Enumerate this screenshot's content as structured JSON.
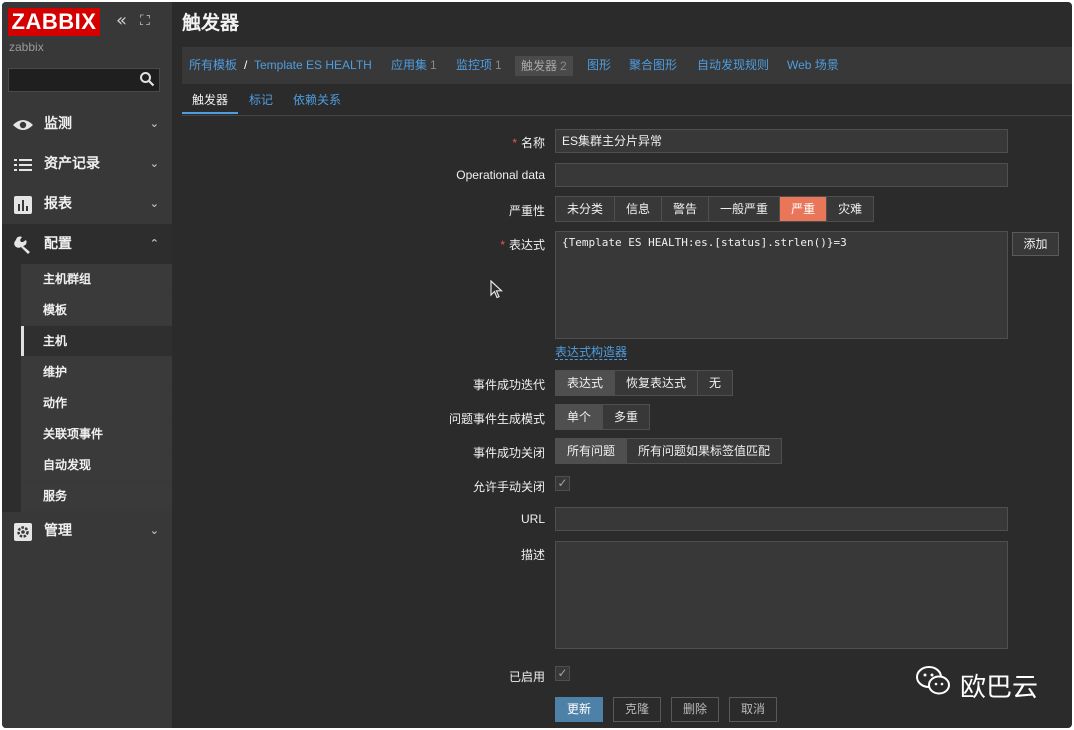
{
  "sidebar": {
    "logo": "ZABBIX",
    "collapse_icon": "«",
    "kiosk_icon": "⛶",
    "server_name": "zabbix",
    "search": {
      "value": "",
      "placeholder": ""
    },
    "menus": [
      {
        "label": "监测",
        "icon": "eye-icon"
      },
      {
        "label": "资产记录",
        "icon": "list-icon"
      },
      {
        "label": "报表",
        "icon": "bar-chart-icon"
      },
      {
        "label": "配置",
        "icon": "wrench-icon"
      },
      {
        "label": "管理",
        "icon": "gear-icon"
      }
    ],
    "submenu": [
      "主机群组",
      "模板",
      "主机",
      "维护",
      "动作",
      "关联项事件",
      "自动发现",
      "服务"
    ]
  },
  "page": {
    "title": "触发器"
  },
  "breadcrumb": {
    "all_templates": "所有模板",
    "separator": "/",
    "template": "Template ES HEALTH",
    "applications": "应用集",
    "applications_count": "1",
    "items": "监控项",
    "items_count": "1",
    "triggers": "触发器",
    "triggers_count": "2",
    "graphs": "图形",
    "screens": "聚合图形",
    "discovery": "自动发现规则",
    "web": "Web 场景"
  },
  "tabs": [
    "触发器",
    "标记",
    "依赖关系"
  ],
  "form": {
    "required_mark": "*",
    "name_label": "名称",
    "name_value": "ES集群主分片异常",
    "opdata_label": "Operational data",
    "opdata_value": "",
    "severity_label": "严重性",
    "severity_options": [
      "未分类",
      "信息",
      "警告",
      "一般严重",
      "严重",
      "灾难"
    ],
    "severity_selected": "严重",
    "expression_label": "表达式",
    "expression_value": "{Template ES HEALTH:es.[status].strlen()}=3",
    "add_button": "添加",
    "expression_builder": "表达式构造器",
    "ok_event_label": "事件成功迭代",
    "ok_event_options": [
      "表达式",
      "恢复表达式",
      "无"
    ],
    "mode_label": "问题事件生成模式",
    "mode_options": [
      "单个",
      "多重"
    ],
    "close_label": "事件成功关闭",
    "close_options": [
      "所有问题",
      "所有问题如果标签值匹配"
    ],
    "manual_close_label": "允许手动关闭",
    "manual_close_checked": true,
    "url_label": "URL",
    "url_value": "",
    "desc_label": "描述",
    "desc_value": "",
    "enabled_label": "已启用",
    "enabled_checked": true,
    "check_mark": "✓"
  },
  "buttons": {
    "update": "更新",
    "clone": "克隆",
    "delete": "删除",
    "cancel": "取消"
  },
  "watermark": {
    "text": "欧巴云",
    "icon": "wechat-icon"
  },
  "colors": {
    "logo": "#d40000",
    "link": "#4f9de0",
    "severity_high": "#e97659",
    "primary_button": "#4e81a8",
    "required": "#e45959"
  }
}
